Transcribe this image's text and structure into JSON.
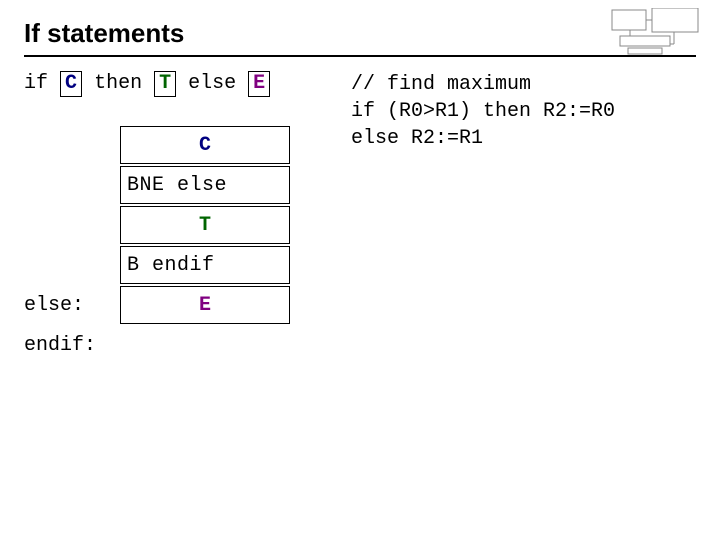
{
  "title": "If statements",
  "syntax": {
    "if": "if",
    "C": "C",
    "then": "then",
    "T": "T",
    "else": "else",
    "E": "E"
  },
  "asm": {
    "box_C": "C",
    "bne": "BNE else",
    "box_T": "T",
    "b_endif": "B   endif",
    "lbl_else": "else:",
    "box_E": "E",
    "lbl_endif": "endif:"
  },
  "code": {
    "l1": "// find maximum",
    "l2": "if (R0>R1) then R2:=R0",
    "l3": "else R2:=R1"
  }
}
